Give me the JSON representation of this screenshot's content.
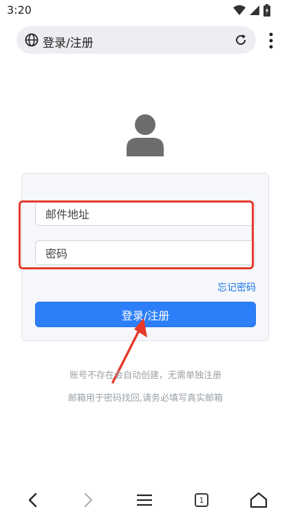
{
  "status_bar": {
    "time": "3:20",
    "icons": [
      "wifi-icon",
      "signal-icon",
      "battery-charging-icon"
    ]
  },
  "address_bar": {
    "title": "登录/注册",
    "left_icon": "globe-icon",
    "right_icon": "reload-icon",
    "menu_icon": "more-vertical-icon"
  },
  "login_form": {
    "avatar_icon": "user-avatar-icon",
    "email_placeholder": "邮件地址",
    "password_placeholder": "密码",
    "forgot_password": "忘记密码",
    "submit_label": "登录/注册"
  },
  "notes": {
    "line1": "账号不存在会自动创建，无需单独注册",
    "line2": "邮箱用于密码找回,请务必填写真实邮箱"
  },
  "nav_bar": {
    "tab_count": "1",
    "icons": [
      "back-icon",
      "forward-icon",
      "menu-icon",
      "tabs-icon",
      "home-icon"
    ]
  },
  "colors": {
    "primary": "#2d7ff9",
    "link": "#1a73e8",
    "annotation": "#e8382c",
    "card_bg": "#f5f7fa"
  }
}
